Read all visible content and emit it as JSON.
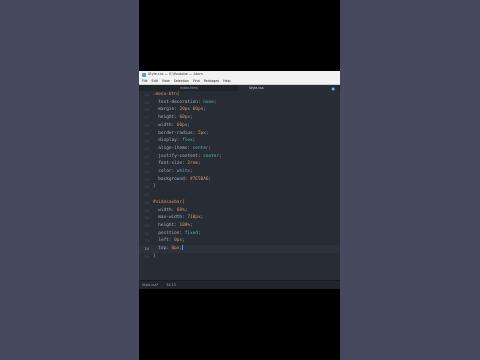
{
  "window": {
    "title": "Style.css — E:\\Youtube — Atom"
  },
  "menu": [
    "File",
    "Edit",
    "View",
    "Selection",
    "Find",
    "Packages",
    "Help"
  ],
  "tabs": [
    {
      "label": "index.html",
      "active": false
    },
    {
      "label": "Style.css",
      "active": true,
      "close": "●"
    }
  ],
  "code_lines": [
    {
      "num": "14",
      "tokens": [
        {
          "t": "sel",
          "v": ".menu-btn{"
        }
      ]
    },
    {
      "num": "15",
      "tokens": [
        {
          "t": "prop",
          "v": "  text-decoration: "
        },
        {
          "t": "kw",
          "v": "none"
        },
        {
          "t": "brace",
          "v": ";"
        }
      ]
    },
    {
      "num": "16",
      "tokens": [
        {
          "t": "prop",
          "v": "  margin: "
        },
        {
          "t": "val",
          "v": "20px 60px"
        },
        {
          "t": "brace",
          "v": ";"
        }
      ]
    },
    {
      "num": "17",
      "tokens": [
        {
          "t": "prop",
          "v": "  height: "
        },
        {
          "t": "val",
          "v": "60px"
        },
        {
          "t": "brace",
          "v": ";"
        }
      ]
    },
    {
      "num": "18",
      "tokens": [
        {
          "t": "prop",
          "v": "  width: "
        },
        {
          "t": "val",
          "v": "60px"
        },
        {
          "t": "brace",
          "v": ";"
        }
      ]
    },
    {
      "num": "19",
      "tokens": [
        {
          "t": "prop",
          "v": "  border-radius: "
        },
        {
          "t": "val",
          "v": "5px"
        },
        {
          "t": "brace",
          "v": ";"
        }
      ]
    },
    {
      "num": "20",
      "tokens": [
        {
          "t": "prop",
          "v": "  display: "
        },
        {
          "t": "kw",
          "v": "flex"
        },
        {
          "t": "brace",
          "v": ";"
        }
      ]
    },
    {
      "num": "21",
      "tokens": [
        {
          "t": "prop",
          "v": "  align-items: "
        },
        {
          "t": "kw",
          "v": "center"
        },
        {
          "t": "brace",
          "v": ";"
        }
      ]
    },
    {
      "num": "22",
      "tokens": [
        {
          "t": "prop",
          "v": "  justify-content: "
        },
        {
          "t": "kw",
          "v": "center"
        },
        {
          "t": "brace",
          "v": ";"
        }
      ]
    },
    {
      "num": "23",
      "tokens": [
        {
          "t": "prop",
          "v": "  font-size: "
        },
        {
          "t": "val",
          "v": "2rem"
        },
        {
          "t": "brace",
          "v": ";"
        }
      ]
    },
    {
      "num": "24",
      "tokens": [
        {
          "t": "prop",
          "v": "  color: "
        },
        {
          "t": "kw",
          "v": "white"
        },
        {
          "t": "brace",
          "v": ";"
        }
      ]
    },
    {
      "num": "25",
      "tokens": [
        {
          "t": "prop",
          "v": "  background: "
        },
        {
          "t": "val",
          "v": "#7E5BA6"
        },
        {
          "t": "brace",
          "v": ";"
        }
      ]
    },
    {
      "num": "26",
      "tokens": [
        {
          "t": "brace",
          "v": "}"
        }
      ]
    },
    {
      "num": "27",
      "tokens": []
    },
    {
      "num": "28",
      "tokens": [
        {
          "t": "sel",
          "v": "#sidesavbar{"
        }
      ]
    },
    {
      "num": "29",
      "tokens": [
        {
          "t": "prop",
          "v": "  width: "
        },
        {
          "t": "val",
          "v": "60%"
        },
        {
          "t": "brace",
          "v": ";"
        }
      ]
    },
    {
      "num": "30",
      "tokens": [
        {
          "t": "prop",
          "v": "  max-width: "
        },
        {
          "t": "val",
          "v": "710px"
        },
        {
          "t": "brace",
          "v": ";"
        }
      ]
    },
    {
      "num": "31",
      "tokens": [
        {
          "t": "prop",
          "v": "  height: "
        },
        {
          "t": "val",
          "v": "100%"
        },
        {
          "t": "brace",
          "v": ";"
        }
      ]
    },
    {
      "num": "32",
      "tokens": [
        {
          "t": "prop",
          "v": "  position: "
        },
        {
          "t": "kw",
          "v": "fixed"
        },
        {
          "t": "brace",
          "v": ";"
        }
      ]
    },
    {
      "num": "33",
      "tokens": [
        {
          "t": "prop",
          "v": "  left: "
        },
        {
          "t": "val",
          "v": "0px"
        },
        {
          "t": "brace",
          "v": ";"
        }
      ]
    },
    {
      "num": "34",
      "tokens": [
        {
          "t": "prop",
          "v": "  top: "
        },
        {
          "t": "val",
          "v": "0px"
        },
        {
          "t": "brace",
          "v": ";"
        }
      ],
      "active": true
    },
    {
      "num": "35",
      "tokens": [
        {
          "t": "brace",
          "v": "}"
        }
      ]
    }
  ],
  "status": {
    "file": "Style.css*",
    "position": "34:13"
  },
  "colors": {
    "page_bg": "#474a5e",
    "editor_bg": "#282c34",
    "selector": "#d19a66",
    "keyword": "#56b6c2"
  }
}
